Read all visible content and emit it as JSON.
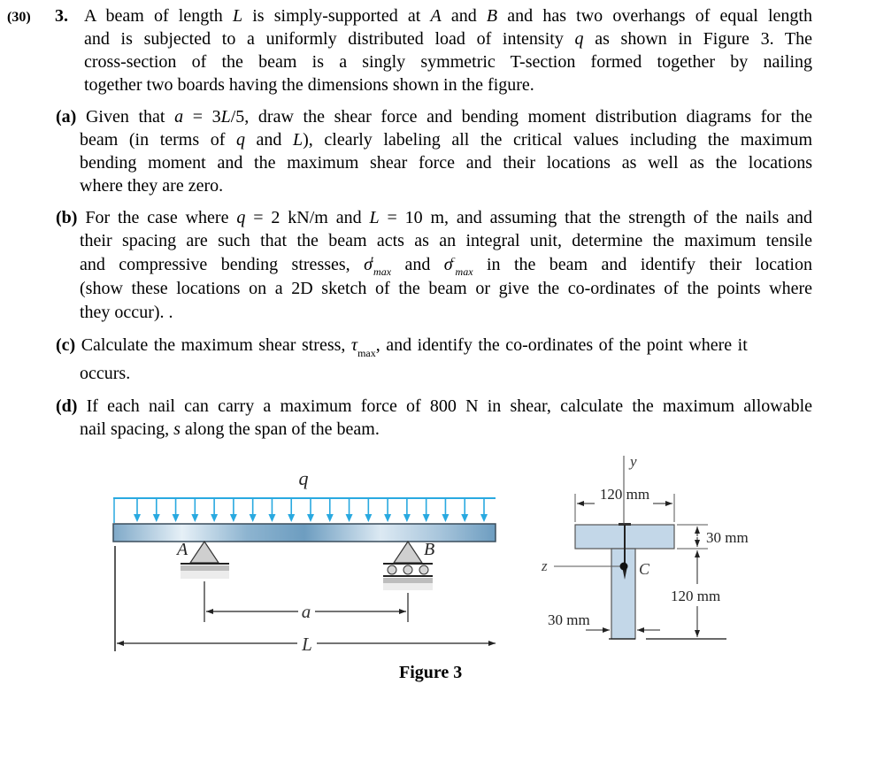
{
  "problem": {
    "marks": "(30)",
    "number": "3.",
    "intro_lines": [
      [
        "A beam of length ",
        "L",
        " is simply-supported at ",
        "A",
        " and ",
        "B",
        " and has two overhangs of equal length"
      ],
      [
        "and is subjected to a uniformly distributed load of intensity ",
        "q",
        " as shown in Figure 3.  The"
      ],
      [
        "cross-section of the beam is a singly symmetric T-section formed together by nailing"
      ],
      [
        "together two boards having the dimensions shown in the figure."
      ]
    ],
    "intro": {
      "l1a": "A beam of length ",
      "l1b": "L",
      "l1c": " is simply-supported at ",
      "l1d": "A",
      "l1e": " and ",
      "l1f": "B",
      "l1g": " and has two overhangs of equal length",
      "l2a": "and is subjected to a uniformly distributed load of intensity ",
      "l2b": "q",
      "l2c": " as shown in Figure 3.  The",
      "l3": "cross-section of the beam is a singly symmetric T-section formed together by nailing",
      "l4": "together two boards having the dimensions shown in the figure."
    },
    "parts": {
      "a": {
        "label": "(a)",
        "l1a": " Given that ",
        "l1b": "a",
        "l1c": " = 3",
        "l1d": "L",
        "l1e": "/5, draw the shear force and bending moment distribution diagrams for the",
        "l2a": "beam (in terms of ",
        "l2b": "q",
        "l2c": " and ",
        "l2d": "L",
        "l2e": "), clearly labeling all the critical values including the maximum",
        "l3": "bending moment and the maximum shear force and their locations as well as the locations",
        "l4": "where they are zero."
      },
      "b": {
        "label": "(b)",
        "l1a": " For the case where ",
        "l1b": "q",
        "l1c": " = 2 kN/m and ",
        "l1d": "L",
        "l1e": " = 10 m, and assuming that the strength of the nails and",
        "l2": "their spacing are such that the beam acts as an integral unit, determine the maximum tensile",
        "l3a": "and compressive bending stresses, ",
        "sigma": "σ",
        "sup_t": "t",
        "sup_c": "c",
        "sub_max": "max",
        "l3b": " and ",
        "l3c": " in the beam and identify their location",
        "l4": "(show these locations on a 2D sketch of the beam or give the co-ordinates of the points where",
        "l5": "they occur).  ."
      },
      "c": {
        "label": "(c)",
        "l1a": " Calculate the maximum shear stress, ",
        "tau": "τ",
        "sub_max": "max",
        "l1b": ", and identify the co-ordinates of the point where it",
        "l2": "occurs."
      },
      "d": {
        "label": "(d)",
        "l1": " If each nail can carry a maximum force of 800 N in shear, calculate the maximum allowable",
        "l2a": "nail spacing, ",
        "l2b": "s",
        "l2c": " along the span of the beam."
      }
    }
  },
  "figure": {
    "caption": "Figure 3",
    "beam": {
      "load_label": "q",
      "support_a_label": "A",
      "support_b_label": "B",
      "dim_a_label": "a",
      "dim_l_label": "L",
      "arrow_count": 19
    },
    "section": {
      "y_axis_label": "y",
      "z_axis_label": "z",
      "centroid_label": "C",
      "flange_width": "120 mm",
      "flange_thickness": "30 mm",
      "web_height": "120 mm",
      "web_width": "30 mm"
    },
    "colors": {
      "load_arrow": "#29a9e0",
      "beam_fill": "#a8c8de",
      "section_fill": "#c3d7e8",
      "support_fill": "#cccccc"
    }
  }
}
